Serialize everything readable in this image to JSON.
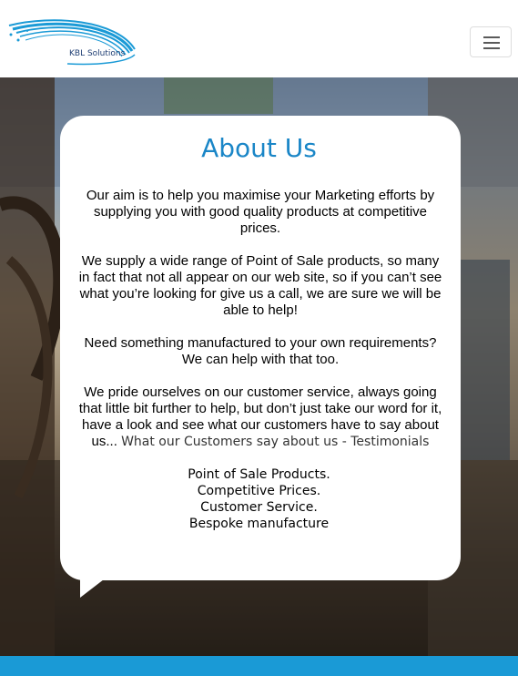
{
  "header": {
    "logo_text": "KBL Solutions",
    "menu_icon": "hamburger-icon"
  },
  "colors": {
    "accent": "#1a86c7",
    "footer": "#1a9ad6"
  },
  "about": {
    "title": "About Us",
    "p1": "Our aim is to help you maximise your Marketing efforts by supplying you with good quality products at competitive prices.",
    "p2": "We supply a wide range of Point of Sale products, so many in fact that not all appear on our web site, so if you can’t see what you’re looking for give us a call, we are sure we will be able to help!",
    "p3": "Need something manufactured to your own requirements? We can help with that too.",
    "p4_text": "We pride ourselves on our customer service, always going that little bit further to help, but don’t just take our word for it, have a look and see what our customers have to say about us...",
    "p4_link": "What our Customers say about us - Testimonials",
    "features": [
      "Point of Sale Products.",
      "Competitive Prices.",
      "Customer Service.",
      "Bespoke manufacture"
    ]
  }
}
